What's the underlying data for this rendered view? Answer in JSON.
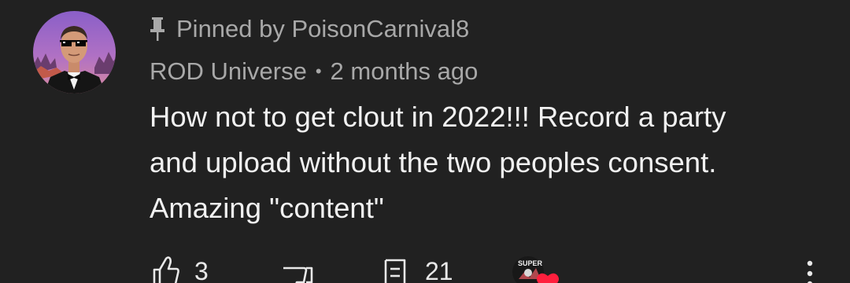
{
  "pinned": {
    "icon": "pin-icon",
    "text": "Pinned by PoisonCarnival8"
  },
  "comment": {
    "author": "ROD Universe",
    "separator": "•",
    "time": "2 months ago",
    "lines": [
      "How not to get clout in 2022!!! Record a party",
      "and upload without the two peoples consent.",
      "Amazing \"content\""
    ]
  },
  "actions": {
    "likes": "3",
    "replies": "21",
    "creator_badge_text": "SUPER",
    "icons": {
      "like": "thumbs-up-icon",
      "dislike": "thumbs-down-icon",
      "reply": "reply-icon",
      "more": "more-vert-icon",
      "heart": "heart-icon"
    }
  },
  "colors": {
    "background": "#212121",
    "text_primary": "#f1f1f1",
    "text_secondary": "#a8a8a8",
    "heart": "#ff1f3d"
  }
}
